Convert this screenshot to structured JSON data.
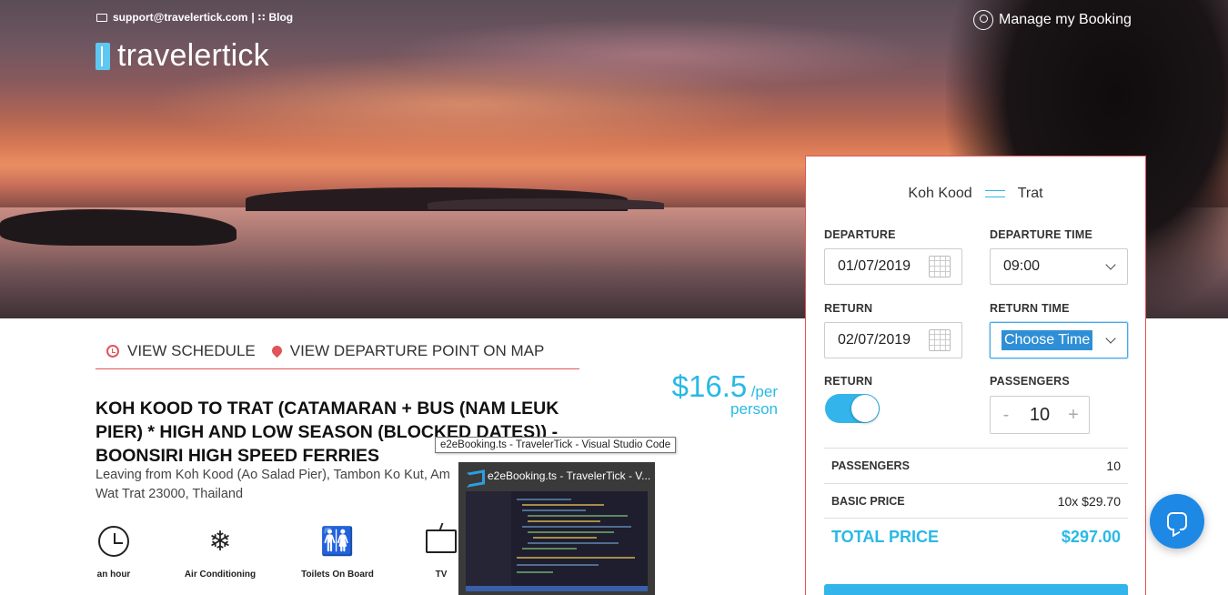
{
  "header": {
    "email": "support@travelertick.com",
    "separator": "|",
    "blog_label": "Blog",
    "logo_text": "travelertick",
    "manage_booking": "Manage my Booking"
  },
  "tabs": [
    {
      "label": "VIEW SCHEDULE",
      "icon": "clock-icon"
    },
    {
      "label": "VIEW DEPARTURE POINT ON MAP",
      "icon": "map-pin-icon"
    }
  ],
  "trip": {
    "title": "KOH KOOD TO TRAT (CATAMARAN + BUS (NAM LEUK PIER) * HIGH AND LOW SEASON (BLOCKED DATES)) - BOONSIRI HIGH SPEED FERRIES",
    "price": "$16.5",
    "per": "/per",
    "person": "person",
    "address_line1": "Leaving from Koh Kood (Ao Salad Pier), Tambon Ko Kut, Am",
    "address_line2": "Wat Trat 23000, Thailand"
  },
  "amenities": [
    {
      "label": "an hour",
      "icon": "clock-icon"
    },
    {
      "label": "Air Conditioning",
      "icon": "snowflake-icon"
    },
    {
      "label": "Toilets On Board",
      "icon": "restroom-icon"
    },
    {
      "label": "TV",
      "icon": "tv-icon"
    }
  ],
  "taskbar": {
    "tooltip": "e2eBooking.ts - TravelerTick - Visual Studio Code",
    "preview_title": "e2eBooking.ts - TravelerTick - V..."
  },
  "booking": {
    "from": "Koh Kood",
    "to": "Trat",
    "departure_label": "DEPARTURE",
    "departure_value": "01/07/2019",
    "departure_time_label": "DEPARTURE TIME",
    "departure_time_value": "09:00",
    "return_label": "RETURN",
    "return_value": "02/07/2019",
    "return_time_label": "RETURN TIME",
    "return_time_value": "Choose Time",
    "return_toggle_label": "RETURN",
    "return_toggle_on": true,
    "passengers_label": "PASSENGERS",
    "passengers_value": "10",
    "minus": "-",
    "plus": "+",
    "summary": {
      "passengers_label": "PASSENGERS",
      "passengers_value": "10",
      "basic_price_label": "BASIC PRICE",
      "basic_price_value": "10x $29.70",
      "total_label": "TOTAL PRICE",
      "total_value": "$297.00"
    }
  },
  "colors": {
    "accent": "#29b9e6",
    "brand_red": "#e2555a",
    "chat": "#1e88e5"
  }
}
